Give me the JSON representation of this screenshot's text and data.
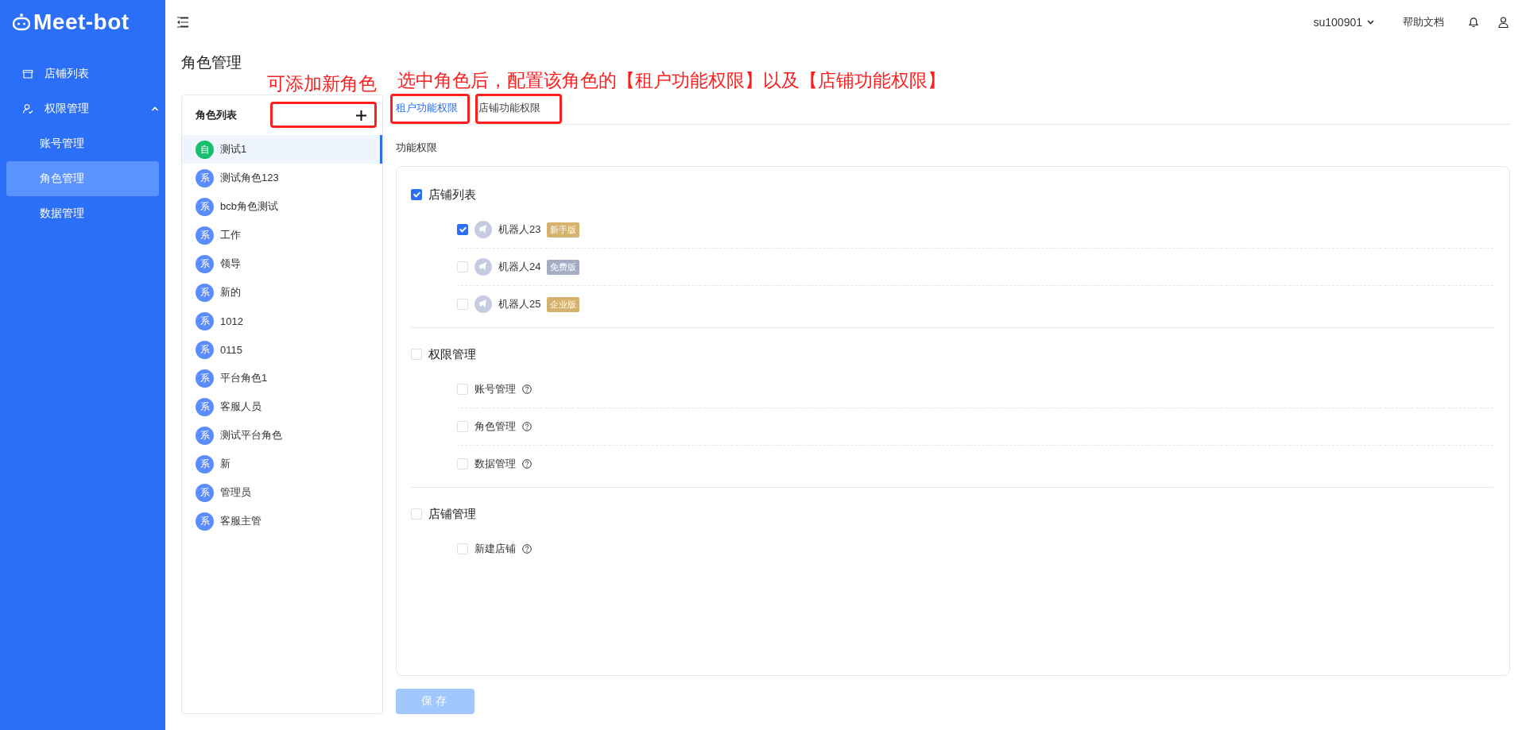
{
  "logo": {
    "text": "Meet-bot"
  },
  "sidebar": {
    "items": [
      {
        "kind": "link",
        "label": "店铺列表",
        "selected": false
      },
      {
        "kind": "group",
        "label": "权限管理",
        "expanded": true,
        "children": [
          {
            "label": "账号管理",
            "selected": false
          },
          {
            "label": "角色管理",
            "selected": true
          },
          {
            "label": "数据管理",
            "selected": false
          }
        ]
      }
    ]
  },
  "header": {
    "user": "su100901",
    "help": "帮助文档"
  },
  "page_title": "角色管理",
  "role_list": {
    "title": "角色列表",
    "roles": [
      {
        "badge": "自",
        "name": "测试1",
        "color": "#19be6b",
        "selected": true
      },
      {
        "badge": "系",
        "name": "测试角色123",
        "color": "#5b8cff",
        "selected": false
      },
      {
        "badge": "系",
        "name": "bcb角色测试",
        "color": "#5b8cff",
        "selected": false
      },
      {
        "badge": "系",
        "name": "工作",
        "color": "#5b8cff",
        "selected": false
      },
      {
        "badge": "系",
        "name": "领导",
        "color": "#5b8cff",
        "selected": false
      },
      {
        "badge": "系",
        "name": "新的",
        "color": "#5b8cff",
        "selected": false
      },
      {
        "badge": "系",
        "name": "1012",
        "color": "#5b8cff",
        "selected": false
      },
      {
        "badge": "系",
        "name": "0115",
        "color": "#5b8cff",
        "selected": false
      },
      {
        "badge": "系",
        "name": "平台角色1",
        "color": "#5b8cff",
        "selected": false
      },
      {
        "badge": "系",
        "name": "客服人员",
        "color": "#5b8cff",
        "selected": false
      },
      {
        "badge": "系",
        "name": "测试平台角色",
        "color": "#5b8cff",
        "selected": false
      },
      {
        "badge": "系",
        "name": "新",
        "color": "#5b8cff",
        "selected": false
      },
      {
        "badge": "系",
        "name": "管理员",
        "color": "#5b8cff",
        "selected": false
      },
      {
        "badge": "系",
        "name": "客服主管",
        "color": "#5b8cff",
        "selected": false
      }
    ]
  },
  "tabs": [
    {
      "label": "租户功能权限",
      "selected": true
    },
    {
      "label": "店铺功能权限",
      "selected": false
    }
  ],
  "section_label": "功能权限",
  "permission_groups": [
    {
      "label": "店铺列表",
      "checked": true,
      "children": [
        {
          "kind": "robot",
          "label": "机器人23",
          "tag": "新手版",
          "color": "#d6b26e",
          "checked": true
        },
        {
          "kind": "robot",
          "label": "机器人24",
          "tag": "免费版",
          "color": "#a4adc1",
          "checked": false
        },
        {
          "kind": "robot",
          "label": "机器人25",
          "tag": "企业版",
          "color": "#d6b26e",
          "checked": false
        }
      ]
    },
    {
      "label": "权限管理",
      "checked": false,
      "children": [
        {
          "kind": "help",
          "label": "账号管理",
          "checked": false
        },
        {
          "kind": "help",
          "label": "角色管理",
          "checked": false
        },
        {
          "kind": "help",
          "label": "数据管理",
          "checked": false
        }
      ]
    },
    {
      "label": "店铺管理",
      "checked": false,
      "children": [
        {
          "kind": "help",
          "label": "新建店铺",
          "checked": false
        }
      ]
    }
  ],
  "save_button": {
    "label": "保存",
    "disabled": true
  },
  "annotations": [
    {
      "text": "可添加新角色"
    },
    {
      "text": "选中角色后，配置该角色的【租户功能权限】以及【店铺功能权限】"
    }
  ]
}
